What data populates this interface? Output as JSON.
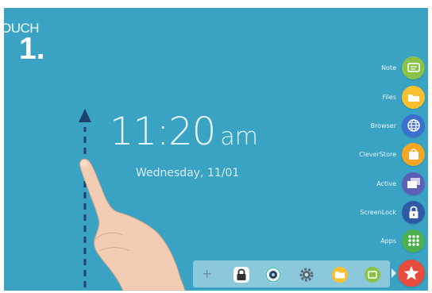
{
  "overlay": {
    "touch_label": "OUCH",
    "step_number": "1."
  },
  "home": {
    "time": "11:20",
    "ampm": "am",
    "date": "Wednesday, 11/01"
  },
  "sidebar": {
    "items": [
      {
        "label": "Note",
        "icon": "note-icon",
        "color": "#8bc34a"
      },
      {
        "label": "Files",
        "icon": "folder-icon",
        "color": "#fbc02d"
      },
      {
        "label": "Browser",
        "icon": "globe-icon",
        "color": "#3d6fd1"
      },
      {
        "label": "CleverStore",
        "icon": "shopping-bag-icon",
        "color": "#f5a623"
      },
      {
        "label": "Active",
        "icon": "windows-icon",
        "color": "#5c5fb8"
      },
      {
        "label": "ScreenLock",
        "icon": "lock-icon",
        "color": "#2e5aa8"
      },
      {
        "label": "Apps",
        "icon": "apps-grid-icon",
        "color": "#4caf50"
      }
    ]
  },
  "dock": {
    "add_symbol": "+",
    "icons": [
      "lock-icon",
      "camera-icon",
      "settings-gear-icon",
      "folder-icon",
      "note-icon"
    ]
  },
  "fab": {
    "icon": "star-icon",
    "color": "#e84c3d"
  }
}
